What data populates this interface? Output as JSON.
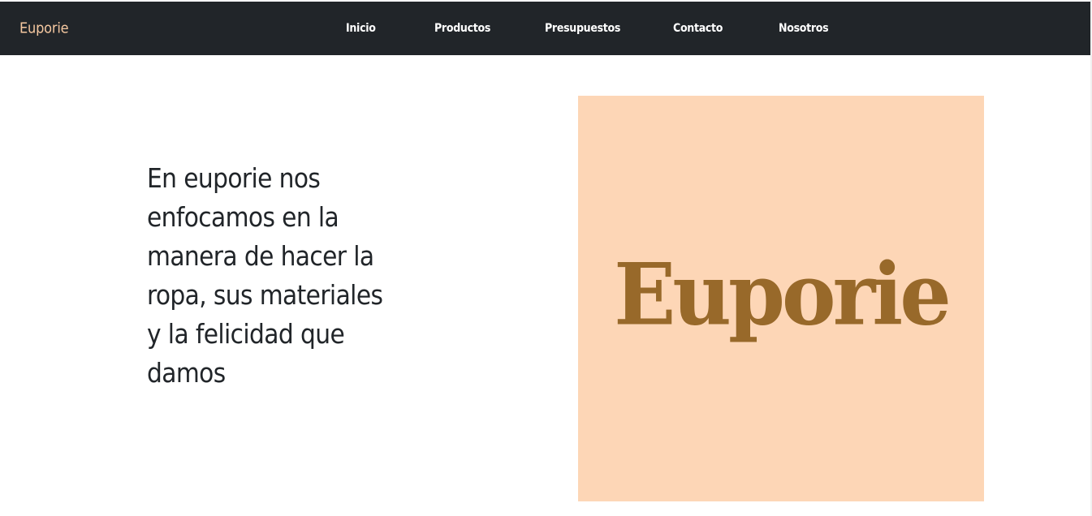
{
  "navbar": {
    "brand": "Euporie",
    "links": [
      {
        "label": "Inicio"
      },
      {
        "label": "Productos"
      },
      {
        "label": "Presupuestos"
      },
      {
        "label": "Contacto"
      },
      {
        "label": "Nosotros"
      }
    ]
  },
  "main": {
    "intro_text": "En euporie nos enfocamos en la manera de hacer la ropa, sus materiales y la felicidad que damos",
    "hero": {
      "logo_text": "Euporie"
    }
  },
  "colors": {
    "navbar_bg": "#212529",
    "brand": "#f5c8a0",
    "hero_bg": "#fdd6b6",
    "hero_logo": "#98692a"
  }
}
